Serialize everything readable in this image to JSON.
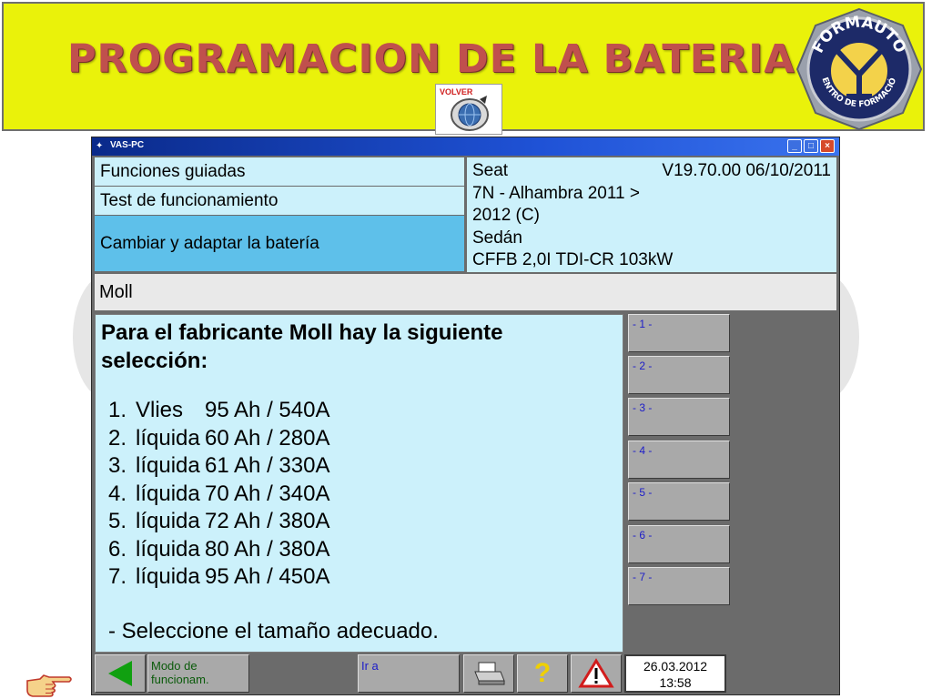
{
  "slide": {
    "title": "PROGRAMACION DE LA BATERIA",
    "volver_label": "VOLVER",
    "logo": {
      "top_text": "FORMAUTO",
      "bottom_text": "CENTRO DE FORMACIÓN"
    }
  },
  "window": {
    "title": "VAS-PC",
    "breadcrumb": [
      "Funciones guiadas",
      "Test de funcionamiento",
      "Cambiar y adaptar la batería"
    ],
    "vehicle": {
      "make": "Seat",
      "version": "V19.70.00 06/10/2011",
      "model_line1": "7N - Alhambra 2011 >",
      "model_line2": "2012 (C)",
      "body": "Sedán",
      "engine": "CFFB 2,0I TDI-CR 103kW"
    },
    "section_title": "Moll",
    "content": {
      "intro": "Para el fabricante Moll  hay la siguiente selección:",
      "options": [
        {
          "num": "1.",
          "type": "Vlies",
          "spec": "95 Ah / 540A"
        },
        {
          "num": "2.",
          "type": "líquida",
          "spec": "60 Ah / 280A"
        },
        {
          "num": "3.",
          "type": "líquida",
          "spec": "61 Ah / 330A"
        },
        {
          "num": "4.",
          "type": "líquida",
          "spec": "70 Ah / 340A"
        },
        {
          "num": "5.",
          "type": "líquida",
          "spec": "72 Ah / 380A"
        },
        {
          "num": "6.",
          "type": "líquida",
          "spec": "80 Ah / 380A"
        },
        {
          "num": "7.",
          "type": "líquida",
          "spec": "95 Ah / 450A"
        }
      ],
      "instruction": "- Seleccione el tamaño adecuado."
    },
    "side_buttons": [
      "- 1 -",
      "- 2 -",
      "- 3 -",
      "- 4 -",
      "- 5 -",
      "- 6 -",
      "- 7 -"
    ],
    "toolbar": {
      "mode_line1": "Modo de",
      "mode_line2": "funcionam.",
      "goto": "Ir a",
      "help": "?",
      "date": "26.03.2012",
      "time": "13:58"
    },
    "colors": {
      "panel_light": "#ccf1fb",
      "panel_selected": "#5ec0ea",
      "back_arrow": "#10a010",
      "slide_header": "#eaf20a",
      "title_text": "#c0504d"
    }
  }
}
